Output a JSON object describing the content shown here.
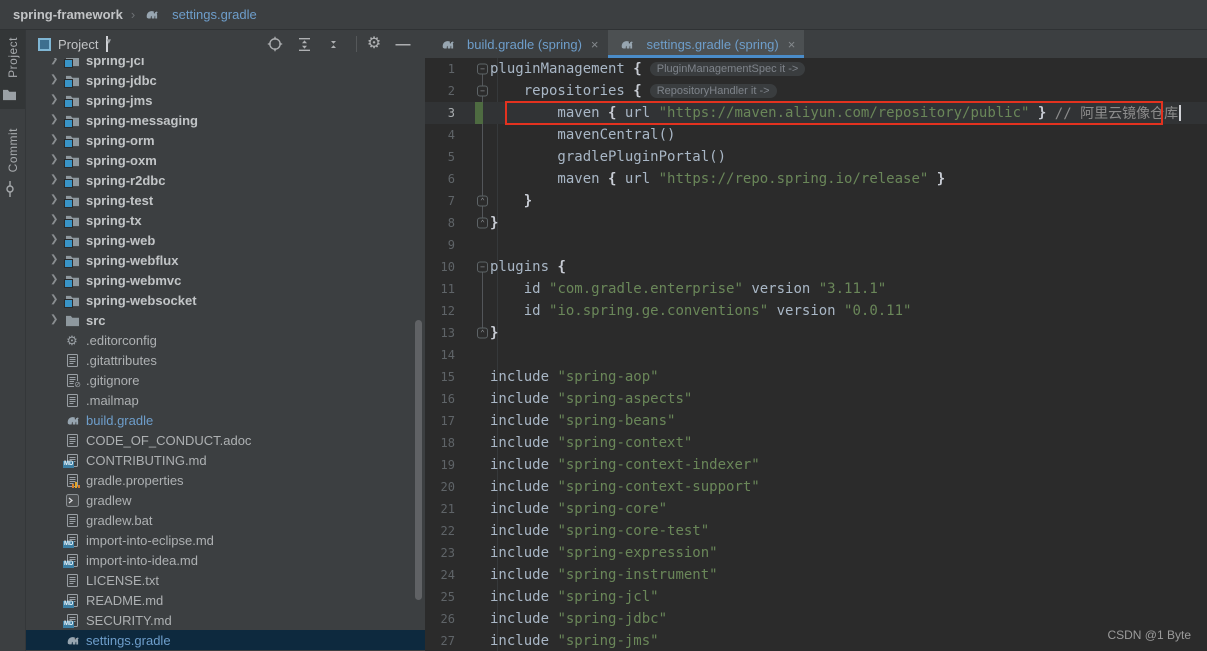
{
  "breadcrumb": {
    "project": "spring-framework",
    "separator": "›",
    "file": "settings.gradle"
  },
  "tool_stripe": {
    "items": [
      {
        "label": "Project",
        "icon": "project-folder-icon",
        "active": true
      },
      {
        "label": "Commit",
        "icon": "commit-icon",
        "active": false
      }
    ]
  },
  "project_panel": {
    "header": {
      "title": "Project",
      "caret": "▾",
      "actions": [
        {
          "name": "locate-opened-file-button",
          "icon": "target-icon"
        },
        {
          "name": "expand-all-button",
          "icon": "expand-all-icon"
        },
        {
          "name": "collapse-all-button",
          "icon": "collapse-all-icon"
        },
        {
          "name": "divider",
          "icon": "divider"
        },
        {
          "name": "settings-button",
          "icon": "gear-icon"
        },
        {
          "name": "hide-panel-button",
          "icon": "minus-icon"
        }
      ]
    },
    "tree": [
      {
        "label": "spring-jcl",
        "kind": "module",
        "icon": "module-folder-icon"
      },
      {
        "label": "spring-jdbc",
        "kind": "module",
        "icon": "module-folder-icon"
      },
      {
        "label": "spring-jms",
        "kind": "module",
        "icon": "module-folder-icon"
      },
      {
        "label": "spring-messaging",
        "kind": "module",
        "icon": "module-folder-icon"
      },
      {
        "label": "spring-orm",
        "kind": "module",
        "icon": "module-folder-icon"
      },
      {
        "label": "spring-oxm",
        "kind": "module",
        "icon": "module-folder-icon"
      },
      {
        "label": "spring-r2dbc",
        "kind": "module",
        "icon": "module-folder-icon"
      },
      {
        "label": "spring-test",
        "kind": "module",
        "icon": "module-folder-icon"
      },
      {
        "label": "spring-tx",
        "kind": "module",
        "icon": "module-folder-icon"
      },
      {
        "label": "spring-web",
        "kind": "module",
        "icon": "module-folder-icon"
      },
      {
        "label": "spring-webflux",
        "kind": "module",
        "icon": "module-folder-icon"
      },
      {
        "label": "spring-webmvc",
        "kind": "module",
        "icon": "module-folder-icon"
      },
      {
        "label": "spring-websocket",
        "kind": "module",
        "icon": "module-folder-icon"
      },
      {
        "label": "src",
        "kind": "folder",
        "icon": "folder-icon"
      },
      {
        "label": ".editorconfig",
        "kind": "file",
        "icon": "editorconfig-gear-icon"
      },
      {
        "label": ".gitattributes",
        "kind": "file",
        "icon": "text-file-icon"
      },
      {
        "label": ".gitignore",
        "kind": "file",
        "icon": "ignore-file-icon"
      },
      {
        "label": ".mailmap",
        "kind": "file",
        "icon": "text-file-icon"
      },
      {
        "label": "build.gradle",
        "kind": "file",
        "icon": "gradle-icon",
        "modified": true
      },
      {
        "label": "CODE_OF_CONDUCT.adoc",
        "kind": "file",
        "icon": "text-file-icon"
      },
      {
        "label": "CONTRIBUTING.md",
        "kind": "file",
        "icon": "markdown-file-icon"
      },
      {
        "label": "gradle.properties",
        "kind": "file",
        "icon": "properties-file-icon"
      },
      {
        "label": "gradlew",
        "kind": "file",
        "icon": "console-file-icon"
      },
      {
        "label": "gradlew.bat",
        "kind": "file",
        "icon": "text-file-icon"
      },
      {
        "label": "import-into-eclipse.md",
        "kind": "file",
        "icon": "markdown-file-icon"
      },
      {
        "label": "import-into-idea.md",
        "kind": "file",
        "icon": "markdown-file-icon"
      },
      {
        "label": "LICENSE.txt",
        "kind": "file",
        "icon": "text-file-icon"
      },
      {
        "label": "README.md",
        "kind": "file",
        "icon": "markdown-file-icon"
      },
      {
        "label": "SECURITY.md",
        "kind": "file",
        "icon": "markdown-file-icon"
      },
      {
        "label": "settings.gradle",
        "kind": "file",
        "icon": "gradle-icon",
        "modified": true,
        "selected": true
      }
    ]
  },
  "editor": {
    "tabs": [
      {
        "label": "build.gradle (spring)",
        "icon": "gradle-icon",
        "close": "×",
        "active": false
      },
      {
        "label": "settings.gradle (spring)",
        "icon": "gradle-icon",
        "close": "×",
        "active": true
      }
    ],
    "fold_lines": [
      {
        "from": 1,
        "to": 8
      },
      {
        "from": 10,
        "to": 13
      }
    ],
    "lines": [
      {
        "n": 1,
        "fold": "open",
        "hint": "PluginManagementSpec it ->",
        "seg": [
          [
            "p",
            "pluginManagement "
          ],
          [
            "b",
            "{"
          ]
        ]
      },
      {
        "n": 2,
        "fold": "open",
        "hint": "RepositoryHandler it ->",
        "seg": [
          [
            "p",
            "    repositories "
          ],
          [
            "b",
            "{"
          ]
        ]
      },
      {
        "n": 3,
        "changed": true,
        "current": true,
        "boxed": true,
        "caret": true,
        "seg": [
          [
            "p",
            "        maven "
          ],
          [
            "b",
            "{"
          ],
          [
            "p",
            " url "
          ],
          [
            "s",
            "\"https://maven.aliyun.com/repository/public\""
          ],
          [
            "p",
            " "
          ],
          [
            "b",
            "}"
          ],
          [
            "p",
            " "
          ],
          [
            "c",
            "// 阿里云镜像仓库"
          ]
        ]
      },
      {
        "n": 4,
        "seg": [
          [
            "p",
            "        mavenCentral()"
          ]
        ]
      },
      {
        "n": 5,
        "seg": [
          [
            "p",
            "        gradlePluginPortal()"
          ]
        ]
      },
      {
        "n": 6,
        "seg": [
          [
            "p",
            "        maven "
          ],
          [
            "b",
            "{"
          ],
          [
            "p",
            " url "
          ],
          [
            "s",
            "\"https://repo.spring.io/release\""
          ],
          [
            "p",
            " "
          ],
          [
            "b",
            "}"
          ]
        ]
      },
      {
        "n": 7,
        "fold": "close",
        "seg": [
          [
            "p",
            "    "
          ],
          [
            "b",
            "}"
          ]
        ]
      },
      {
        "n": 8,
        "fold": "close",
        "seg": [
          [
            "b",
            "}"
          ]
        ]
      },
      {
        "n": 9,
        "seg": []
      },
      {
        "n": 10,
        "fold": "open",
        "seg": [
          [
            "p",
            "plugins "
          ],
          [
            "b",
            "{"
          ]
        ]
      },
      {
        "n": 11,
        "seg": [
          [
            "p",
            "    id "
          ],
          [
            "s",
            "\"com.gradle.enterprise\""
          ],
          [
            "p",
            " version "
          ],
          [
            "s",
            "\"3.11.1\""
          ]
        ]
      },
      {
        "n": 12,
        "seg": [
          [
            "p",
            "    id "
          ],
          [
            "s",
            "\"io.spring.ge.conventions\""
          ],
          [
            "p",
            " version "
          ],
          [
            "s",
            "\"0.0.11\""
          ]
        ]
      },
      {
        "n": 13,
        "fold": "close",
        "seg": [
          [
            "b",
            "}"
          ]
        ]
      },
      {
        "n": 14,
        "seg": []
      },
      {
        "n": 15,
        "seg": [
          [
            "p",
            "include "
          ],
          [
            "s",
            "\"spring-aop\""
          ]
        ]
      },
      {
        "n": 16,
        "seg": [
          [
            "p",
            "include "
          ],
          [
            "s",
            "\"spring-aspects\""
          ]
        ]
      },
      {
        "n": 17,
        "seg": [
          [
            "p",
            "include "
          ],
          [
            "s",
            "\"spring-beans\""
          ]
        ]
      },
      {
        "n": 18,
        "seg": [
          [
            "p",
            "include "
          ],
          [
            "s",
            "\"spring-context\""
          ]
        ]
      },
      {
        "n": 19,
        "seg": [
          [
            "p",
            "include "
          ],
          [
            "s",
            "\"spring-context-indexer\""
          ]
        ]
      },
      {
        "n": 20,
        "seg": [
          [
            "p",
            "include "
          ],
          [
            "s",
            "\"spring-context-support\""
          ]
        ]
      },
      {
        "n": 21,
        "seg": [
          [
            "p",
            "include "
          ],
          [
            "s",
            "\"spring-core\""
          ]
        ]
      },
      {
        "n": 22,
        "seg": [
          [
            "p",
            "include "
          ],
          [
            "s",
            "\"spring-core-test\""
          ]
        ]
      },
      {
        "n": 23,
        "seg": [
          [
            "p",
            "include "
          ],
          [
            "s",
            "\"spring-expression\""
          ]
        ]
      },
      {
        "n": 24,
        "seg": [
          [
            "p",
            "include "
          ],
          [
            "s",
            "\"spring-instrument\""
          ]
        ]
      },
      {
        "n": 25,
        "seg": [
          [
            "p",
            "include "
          ],
          [
            "s",
            "\"spring-jcl\""
          ]
        ]
      },
      {
        "n": 26,
        "seg": [
          [
            "p",
            "include "
          ],
          [
            "s",
            "\"spring-jdbc\""
          ]
        ]
      },
      {
        "n": 27,
        "seg": [
          [
            "p",
            "include "
          ],
          [
            "s",
            "\"spring-jms\""
          ]
        ]
      }
    ]
  },
  "watermark": "CSDN @1 Byte",
  "colors": {
    "panel_bg": "#3C3F41",
    "editor_bg": "#2B2B2B",
    "selection_bg": "#0D293E",
    "tab_underline": "#4A8CC9",
    "file_blue": "#6E9ECB",
    "string_green": "#6A8759",
    "red_box": "#E3321F",
    "change_green": "#4E6B41"
  }
}
